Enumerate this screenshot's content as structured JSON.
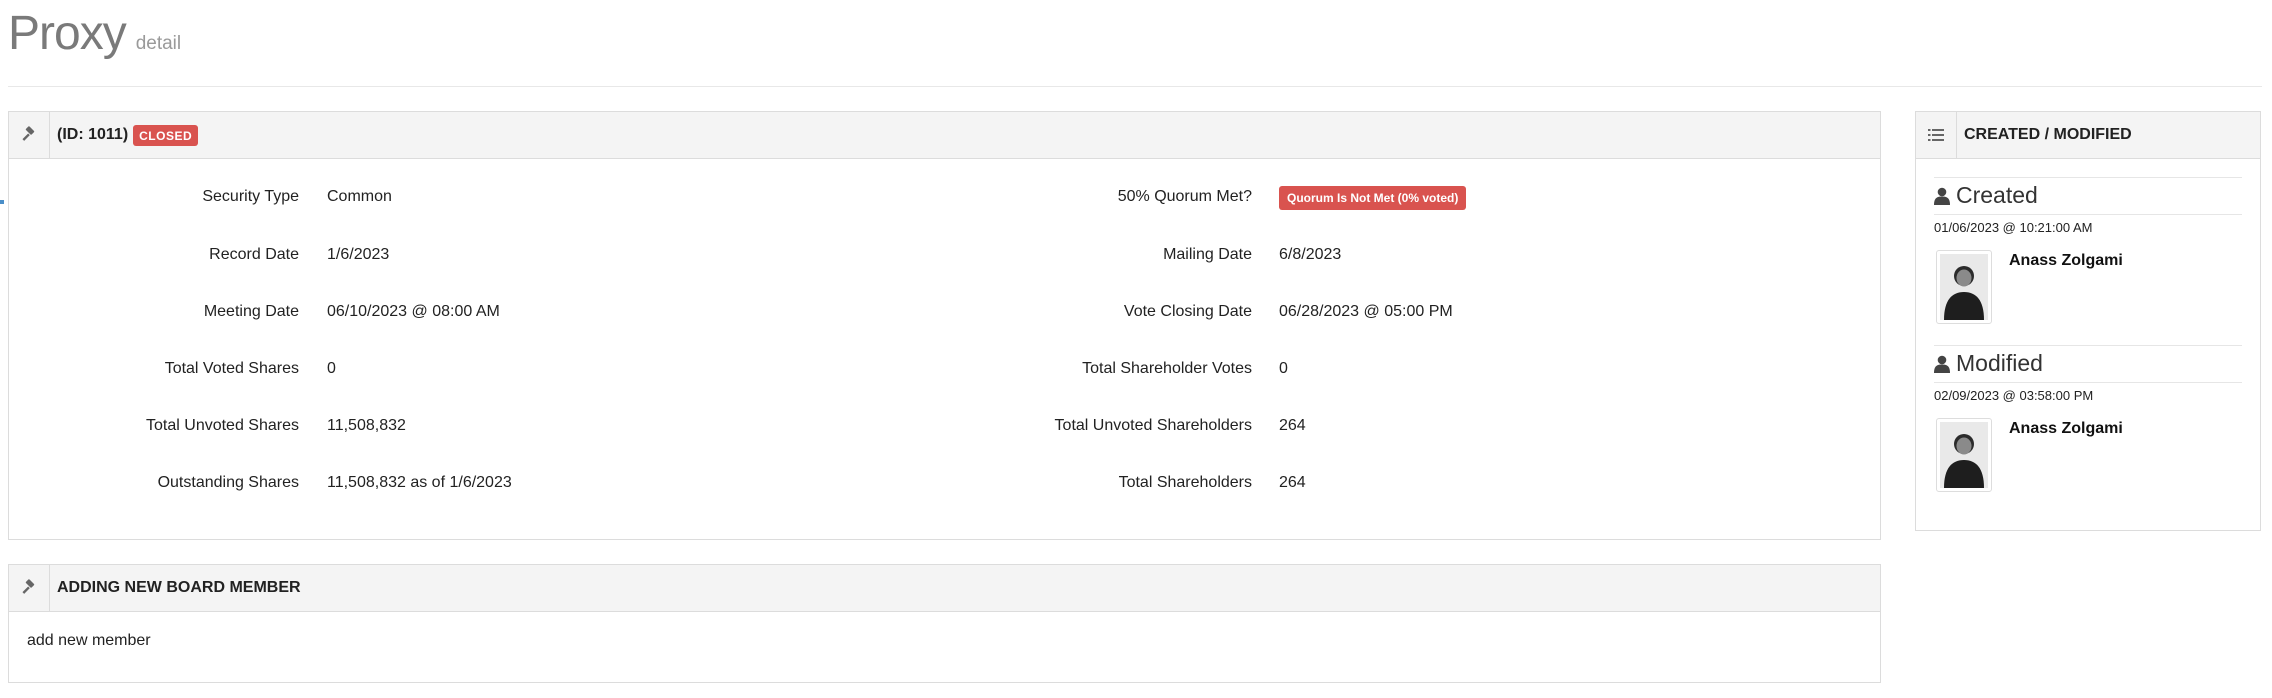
{
  "page": {
    "title": "Proxy",
    "subtitle": "detail"
  },
  "proxy_panel": {
    "id_label": "(ID: 1011)",
    "status_badge": "CLOSED",
    "left_fields": [
      {
        "label": "Security Type",
        "value": "Common"
      },
      {
        "label": "Record Date",
        "value": "1/6/2023"
      },
      {
        "label": "Meeting Date",
        "value": "06/10/2023 @ 08:00 AM"
      },
      {
        "label": "Total Voted Shares",
        "value": "0"
      },
      {
        "label": "Total Unvoted Shares",
        "value": "11,508,832"
      },
      {
        "label": "Outstanding Shares",
        "value": "11,508,832 as of 1/6/2023"
      }
    ],
    "right_fields": [
      {
        "label": "50% Quorum Met?",
        "value": "Quorum Is Not Met (0% voted)"
      },
      {
        "label": "Mailing Date",
        "value": "6/8/2023"
      },
      {
        "label": "Vote Closing Date",
        "value": "06/28/2023 @ 05:00 PM"
      },
      {
        "label": "Total Shareholder Votes",
        "value": "0"
      },
      {
        "label": "Total Unvoted Shareholders",
        "value": "264"
      },
      {
        "label": "Total Shareholders",
        "value": "264"
      }
    ]
  },
  "board_panel": {
    "title": "ADDING NEW BOARD MEMBER",
    "body": "add new member"
  },
  "side_panel": {
    "title": "CREATED / MODIFIED",
    "created": {
      "heading": "Created",
      "date": "01/06/2023 @ 10:21:00 AM",
      "user": "Anass Zolgami"
    },
    "modified": {
      "heading": "Modified",
      "date": "02/09/2023 @ 03:58:00 PM",
      "user": "Anass Zolgami"
    }
  },
  "icons": {
    "panel_icon": "gavel-icon",
    "list_icon": "list-icon",
    "user_icon": "user-icon"
  },
  "colors": {
    "danger": "#d9534f",
    "header_bg": "#f4f4f4",
    "border": "#dcdcdc"
  }
}
